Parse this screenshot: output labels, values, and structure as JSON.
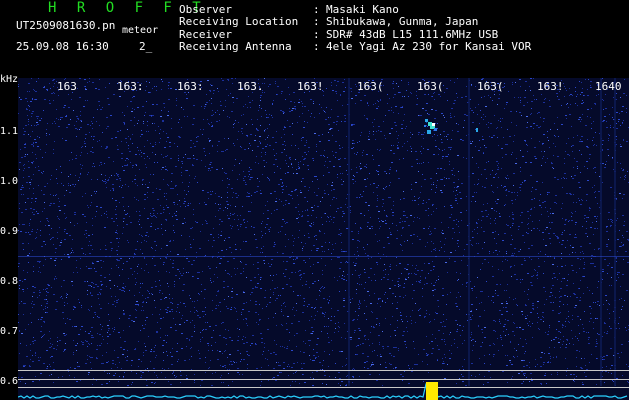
{
  "header": {
    "app_title": "H R O F F T",
    "filename": "UT2509081630.pn",
    "meteor_label": "meteor",
    "datetime": "25.09.08 16:30",
    "count": "2_",
    "info_rows": [
      {
        "key": "Observer",
        "value": "Masaki Kano"
      },
      {
        "key": "Receiving Location",
        "value": "Shibukawa, Gunma, Japan"
      },
      {
        "key": "Receiver",
        "value": "SDR# 43dB L15 111.6MHz USB"
      },
      {
        "key": "Receiving Antenna",
        "value": "4ele Yagi Az 230 for Kansai VOR"
      }
    ]
  },
  "spectrogram": {
    "y_unit": "kHz",
    "y_ticks": [
      "1.1",
      "1.0",
      "0.9",
      "0.8",
      "0.7",
      "0.6"
    ],
    "x_ticks": [
      "163",
      "163:",
      "163:",
      "163.",
      "163!",
      "163(",
      "163(",
      "163(",
      "163!",
      "1640"
    ],
    "colors": {
      "background": "#050a2a",
      "noise": "#1b2f9a",
      "signal": "#3fe0d0",
      "echo": "#ffe800",
      "reference_line": "#c8c8c8"
    }
  }
}
